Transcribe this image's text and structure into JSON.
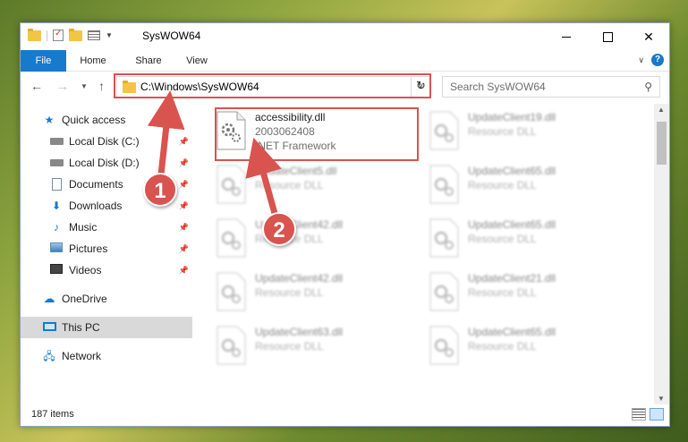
{
  "window": {
    "title": "SysWOW64",
    "caption": {
      "minimize": "",
      "maximize": "",
      "close": "✕"
    }
  },
  "ribbon": {
    "tabs": [
      "File",
      "Home",
      "Share",
      "View"
    ],
    "help": "?"
  },
  "nav": {
    "address": "C:\\Windows\\SysWOW64",
    "search_placeholder": "Search SysWOW64",
    "refresh": "↻"
  },
  "sidebar": {
    "items": [
      {
        "label": "Quick access",
        "icon": "star-icon",
        "pinned": false
      },
      {
        "label": "Local Disk (C:)",
        "icon": "disk-icon",
        "pinned": true
      },
      {
        "label": "Local Disk (D:)",
        "icon": "disk-icon",
        "pinned": true
      },
      {
        "label": "Documents",
        "icon": "documents-icon",
        "pinned": true
      },
      {
        "label": "Downloads",
        "icon": "downloads-icon",
        "pinned": true
      },
      {
        "label": "Music",
        "icon": "music-icon",
        "pinned": true
      },
      {
        "label": "Pictures",
        "icon": "pictures-icon",
        "pinned": true
      },
      {
        "label": "Videos",
        "icon": "videos-icon",
        "pinned": true
      },
      {
        "label": "OneDrive",
        "icon": "onedrive-icon",
        "pinned": false
      },
      {
        "label": "This PC",
        "icon": "this-pc-icon",
        "pinned": false,
        "selected": true
      },
      {
        "label": "Network",
        "icon": "network-icon",
        "pinned": false
      }
    ]
  },
  "files": {
    "highlighted": {
      "name": "accessibility.dll",
      "line1": "2003062408",
      "line2": ".NET Framework"
    },
    "left_column": [
      {
        "name": "UpdateClient5.dll",
        "type": "Resource DLL"
      },
      {
        "name": "UpdateClient42.dll",
        "type": "Resource DLL"
      },
      {
        "name": "UpdateClient42.dll",
        "type": "Resource DLL"
      },
      {
        "name": "UpdateClient63.dll",
        "type": "Resource DLL"
      }
    ],
    "right_column": [
      {
        "name": "UpdateClient19.dll",
        "type": "Resource DLL"
      },
      {
        "name": "UpdateClient65.dll",
        "type": "Resource DLL"
      },
      {
        "name": "UpdateClient65.dll",
        "type": "Resource DLL"
      },
      {
        "name": "UpdateClient21.dll",
        "type": "Resource DLL"
      },
      {
        "name": "UpdateClient65.dll",
        "type": "Resource DLL"
      }
    ]
  },
  "status": {
    "item_count": "187 items"
  },
  "annotations": {
    "step1": "1",
    "step2": "2",
    "color": "#d9534f"
  }
}
